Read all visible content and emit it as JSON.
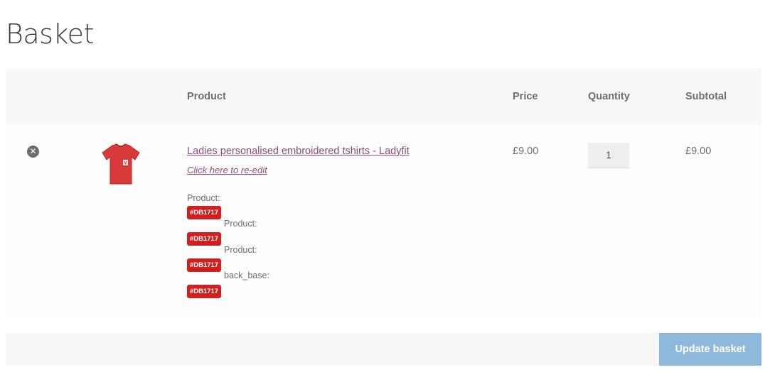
{
  "page": {
    "title": "Basket"
  },
  "table": {
    "headers": {
      "product": "Product",
      "price": "Price",
      "quantity": "Quantity",
      "subtotal": "Subtotal"
    }
  },
  "item": {
    "remove_glyph": "✕",
    "image_icon": "tshirt-icon",
    "name": "Ladies personalised embroidered tshirts - Ladyfit",
    "reedit_label": "Click here to re-edit",
    "meta": [
      {
        "label": "Product:",
        "swatch": "#DB1717"
      },
      {
        "label": "Product:",
        "swatch": "#DB1717"
      },
      {
        "label": "Product:",
        "swatch": "#DB1717"
      },
      {
        "label": "back_base:",
        "swatch": "#DB1717"
      }
    ],
    "price": "£9.00",
    "quantity": "1",
    "subtotal": "£9.00"
  },
  "actions": {
    "update_label": "Update basket"
  },
  "colors": {
    "link": "#8a4c7e",
    "swatch_bg": "#d11f1f",
    "button_bg": "#8fb8dd",
    "header_bg": "#f8f8f8"
  }
}
